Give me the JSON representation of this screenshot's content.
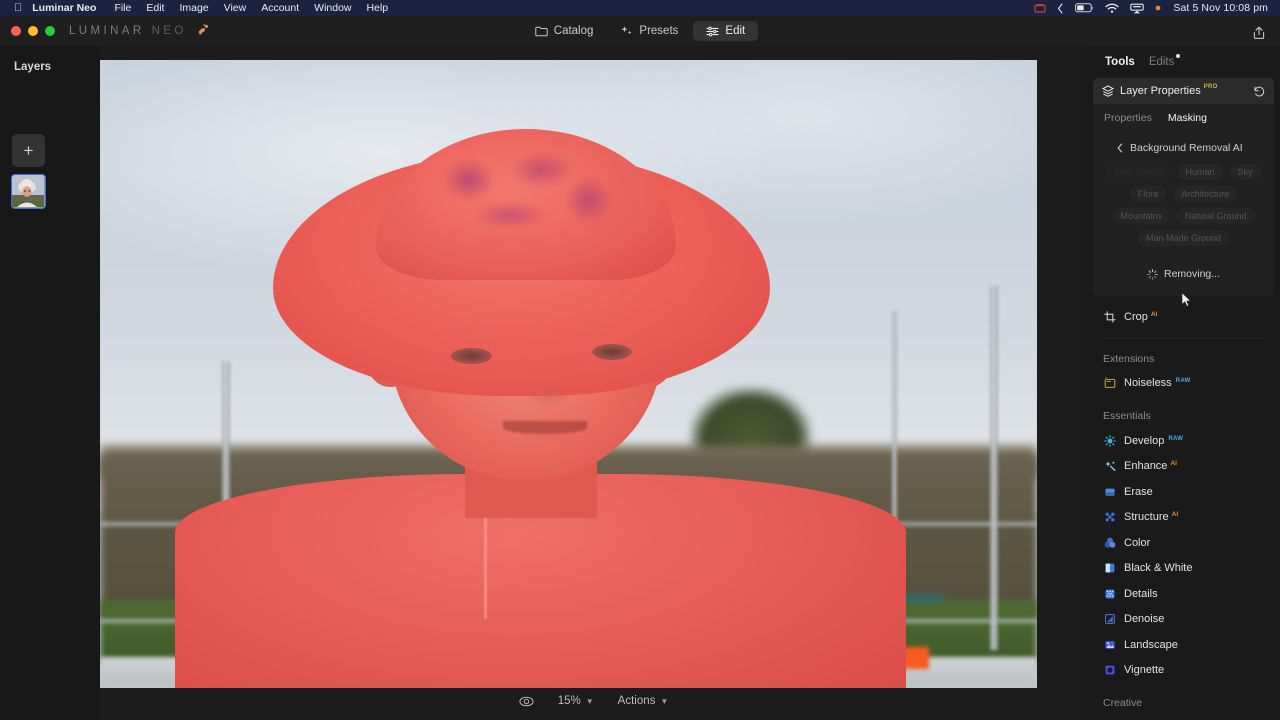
{
  "menubar": {
    "apple_icon": "apple-icon",
    "app_name": "Luminar Neo",
    "items": [
      "File",
      "Edit",
      "Image",
      "View",
      "Account",
      "Window",
      "Help"
    ],
    "status_icons": [
      "screen-recording-icon",
      "control-center-chevron-icon",
      "battery-icon",
      "wifi-icon",
      "airplay-icon",
      "notification-dot-icon"
    ],
    "clock": "Sat 5 Nov  10:08 pm"
  },
  "titlebar": {
    "brand_primary": "LUMINAR",
    "brand_secondary": "NEO",
    "brand_mark": "luminar-logo-icon",
    "tabs": [
      {
        "label": "Catalog",
        "icon": "folder-icon",
        "active": false
      },
      {
        "label": "Presets",
        "icon": "sparkle-icon",
        "active": false
      },
      {
        "label": "Edit",
        "icon": "sliders-icon",
        "active": true
      }
    ],
    "share_icon": "share-icon"
  },
  "left_rail": {
    "title": "Layers",
    "add_button_label": "+",
    "add_button_icon": "plus-icon",
    "layer_thumbnail_name": "layer-thumbnail"
  },
  "canvas": {
    "image_alt": "child-in-pink-hat-photo",
    "mask_overlay_color": "#e8564f",
    "sky_color": "#ccd4de",
    "grass_color": "#4e6b33"
  },
  "bottombar": {
    "preview_icon": "eye-compare-icon",
    "zoom_value": "15%",
    "zoom_caret": "chevron-down-icon",
    "actions_label": "Actions",
    "actions_caret": "chevron-down-icon"
  },
  "right_panel": {
    "tabs": [
      {
        "label": "Tools",
        "active": true,
        "dot": false
      },
      {
        "label": "Edits",
        "active": false,
        "dot": true
      }
    ],
    "layer_properties": {
      "title": "Layer Properties",
      "badge": "PRO",
      "icon": "layers-icon",
      "revert_icon": "revert-arrow-icon",
      "subtabs": [
        {
          "label": "Properties",
          "active": false
        },
        {
          "label": "Masking",
          "active": true
        }
      ],
      "back_label": "Background Removal AI",
      "back_icon": "chevron-left-icon",
      "chips": [
        {
          "label": "Main Object",
          "dimmest": true
        },
        {
          "label": "Human",
          "dimmest": false
        },
        {
          "label": "Sky",
          "dimmest": false
        },
        {
          "label": "Flora",
          "dimmest": false
        },
        {
          "label": "Architecture",
          "dimmest": false
        },
        {
          "label": "Mountains",
          "dimmest": false
        },
        {
          "label": "Natural Ground",
          "dimmest": false
        },
        {
          "label": "Man Made Ground",
          "dimmest": false
        }
      ],
      "status_text": "Removing...",
      "status_icon": "spinner-icon"
    },
    "tools": [
      {
        "label": "Crop",
        "icon": "crop-icon",
        "badge": "AI",
        "badge_type": "ai",
        "color": "#d0d0d0",
        "group": null
      },
      {
        "label": "Extensions",
        "group_header": true
      },
      {
        "label": "Noiseless",
        "icon": "noiseless-icon",
        "badge": "RAW",
        "badge_type": "raw",
        "color": "#c8a24a",
        "group": "Extensions"
      },
      {
        "label": "Essentials",
        "group_header": true
      },
      {
        "label": "Develop",
        "icon": "develop-icon",
        "badge": "RAW",
        "badge_type": "raw",
        "color": "#3fb6e0",
        "group": "Essentials"
      },
      {
        "label": "Enhance",
        "icon": "enhance-icon",
        "badge": "AI",
        "badge_type": "ai",
        "color": "#7fc9e8",
        "group": "Essentials"
      },
      {
        "label": "Erase",
        "icon": "erase-icon",
        "badge": "",
        "badge_type": "",
        "color": "#4f8fd6",
        "group": "Essentials"
      },
      {
        "label": "Structure",
        "icon": "structure-icon",
        "badge": "AI",
        "badge_type": "ai",
        "color": "#3f6fd6",
        "group": "Essentials"
      },
      {
        "label": "Color",
        "icon": "color-icon",
        "badge": "",
        "badge_type": "",
        "color": "#4a7fe0",
        "group": "Essentials"
      },
      {
        "label": "Black & White",
        "icon": "black-white-icon",
        "badge": "",
        "badge_type": "",
        "color": "#3b7fe0",
        "group": "Essentials"
      },
      {
        "label": "Details",
        "icon": "details-icon",
        "badge": "",
        "badge_type": "",
        "color": "#3b7fe0",
        "group": "Essentials"
      },
      {
        "label": "Denoise",
        "icon": "denoise-icon",
        "badge": "",
        "badge_type": "",
        "color": "#4a6fd0",
        "group": "Essentials"
      },
      {
        "label": "Landscape",
        "icon": "landscape-icon",
        "badge": "",
        "badge_type": "",
        "color": "#4a5fd6",
        "group": "Essentials"
      },
      {
        "label": "Vignette",
        "icon": "vignette-icon",
        "badge": "",
        "badge_type": "",
        "color": "#4a4fd6",
        "group": "Essentials"
      },
      {
        "label": "Creative",
        "group_header": true
      }
    ]
  }
}
